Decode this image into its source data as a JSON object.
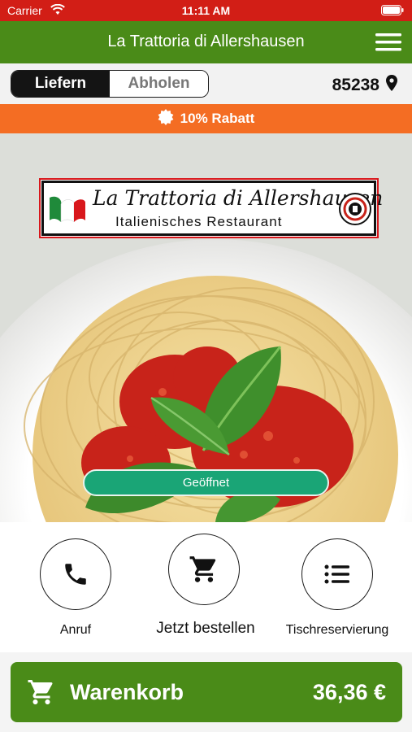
{
  "status_bar": {
    "carrier": "Carrier",
    "time": "11:11 AM"
  },
  "header": {
    "title": "La Trattoria di Allershausen",
    "menu_icon": "hamburger-menu-icon"
  },
  "order_mode": {
    "delivery_label": "Liefern",
    "pickup_label": "Abholen",
    "selected": "delivery"
  },
  "location": {
    "zip": "85238",
    "icon": "location-pin-icon"
  },
  "discount": {
    "text": "10% Rabatt",
    "icon": "badge-icon"
  },
  "logo": {
    "name": "La Trattoria di Allershausen",
    "subtitle": "Italienisches Restaurant"
  },
  "status": {
    "label": "Geöffnet"
  },
  "actions": [
    {
      "label": "Anruf",
      "icon": "phone-icon"
    },
    {
      "label": "Jetzt bestellen",
      "icon": "cart-icon"
    },
    {
      "label": "Tischreservierung",
      "icon": "list-icon"
    }
  ],
  "cart": {
    "label": "Warenkorb",
    "total": "36,36 €",
    "icon": "cart-icon"
  },
  "colors": {
    "green": "#4a8b18",
    "orange": "#f46d23",
    "red_status": "#d21e16",
    "open_green": "#1aa576"
  }
}
